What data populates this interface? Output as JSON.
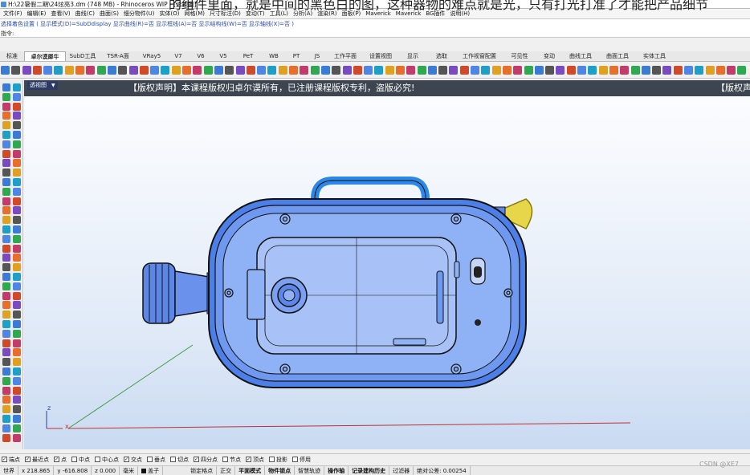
{
  "overlay": {
    "banner": "的组件里面，就是中间的黑色白的图，这种器物的难点就是光，只有打光打准了才能把产品细节"
  },
  "window": {
    "title": "H:\\22暑假二期\\24炫亮3.dm (748 MB) - Rhinoceros WIP - [透视图]"
  },
  "menu": {
    "items": [
      "文件(F)",
      "编辑(E)",
      "查看(V)",
      "曲线(C)",
      "曲面(S)",
      "细分物件(U)",
      "实体(O)",
      "网格(M)",
      "尺寸标注(D)",
      "变动(T)",
      "工具(L)",
      "分析(A)",
      "渲染(R)",
      "面板(P)",
      "Maverick",
      "Maverick",
      "BG插件",
      "说明(H)"
    ]
  },
  "command": {
    "history": "选择着色设置 ( 显示模式(D)=SubDdisplay  显示曲线(R)=否  显示框线(A)=否  显示结构线(W)=否  显示轴线(X)=否 )",
    "prompt": "指令:"
  },
  "tabs": [
    "标准",
    "卓尔谟犀牛",
    "SubD工具",
    "TSR-A面",
    "VRay5",
    "V7",
    "V6",
    "V5",
    "PeT",
    "WB",
    "PT",
    "JS",
    "工作平面",
    "设置视图",
    "显示",
    "选取",
    "工作视窗配置",
    "可见性",
    "变动",
    "曲线工具",
    "曲面工具",
    "实体工具"
  ],
  "active_tab_index": 1,
  "viewport": {
    "name": "透视图",
    "dropdown_glyph": "▼",
    "copyright": "【版权声明】本课程版权归卓尔谟所有，已注册课程版权专利，盗版必究!",
    "copyright_repeat": "【版权声",
    "axis": {
      "x": "x",
      "y": "y",
      "z": "z"
    }
  },
  "osnaps": [
    {
      "label": "端点",
      "checked": true
    },
    {
      "label": "最近点",
      "checked": true
    },
    {
      "label": "点",
      "checked": true
    },
    {
      "label": "中点",
      "checked": false
    },
    {
      "label": "中心点",
      "checked": false
    },
    {
      "label": "交点",
      "checked": true
    },
    {
      "label": "垂点",
      "checked": false
    },
    {
      "label": "切点",
      "checked": false
    },
    {
      "label": "四分点",
      "checked": true
    },
    {
      "label": "节点",
      "checked": false
    },
    {
      "label": "顶点",
      "checked": true
    },
    {
      "label": "投影",
      "checked": false
    },
    {
      "label": "停用",
      "checked": false
    }
  ],
  "status": {
    "cplane": "世界",
    "x": "x 218.865",
    "y": "y -616.808",
    "z": "z 0.000",
    "units": "毫米",
    "layer": "盖子",
    "grid_snap": "锁定格点",
    "ortho": "正交",
    "planar": "平面模式",
    "osnap": "物件锁点",
    "smarttrack": "智慧轨迹",
    "gumball": "操作轴",
    "history": "记录建构历史",
    "filter": "过滤器",
    "tolerance": "绝对公差: 0.00254"
  },
  "watermark": "CSDN @XE7"
}
